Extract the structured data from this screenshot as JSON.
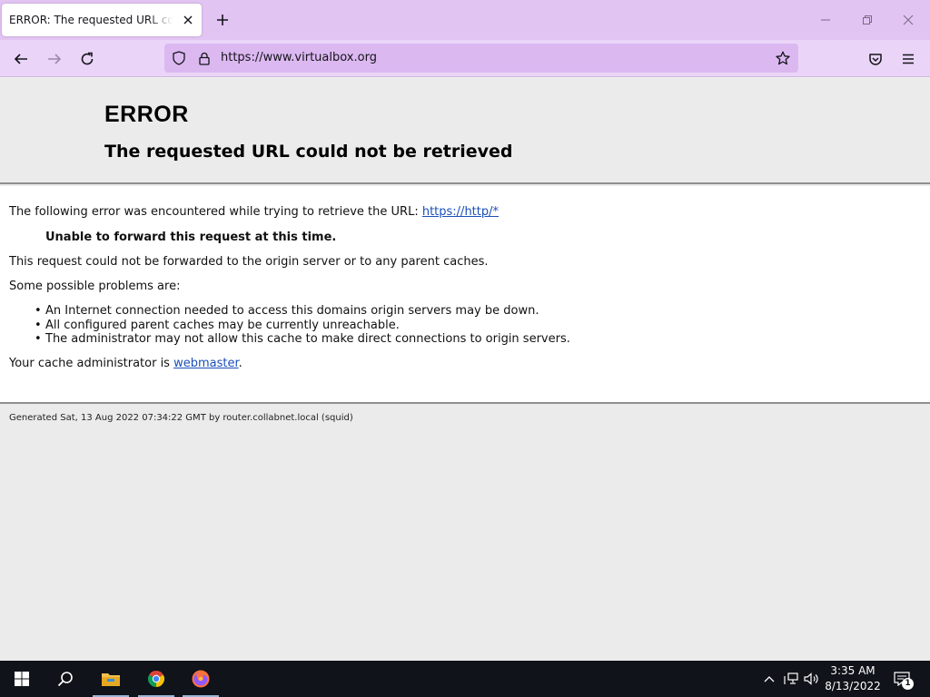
{
  "browser": {
    "tab_title": "ERROR: The requested URL could not be retrieved",
    "url": "https://www.virtualbox.org",
    "icons": {
      "back": "arrow-left-icon",
      "forward": "arrow-right-icon",
      "reload": "reload-icon",
      "shield": "shield-icon",
      "lock": "lock-icon",
      "bookmark": "star-icon",
      "pocket": "pocket-icon",
      "menu": "hamburger-menu-icon",
      "new_tab": "plus-icon",
      "minimize": "minimize-icon",
      "restore": "restore-icon",
      "close": "close-icon"
    }
  },
  "page": {
    "title": "ERROR",
    "subtitle": "The requested URL could not be retrieved",
    "intro_text": "The following error was encountered while trying to retrieve the URL: ",
    "intro_link": "https://http/*",
    "error_summary": "Unable to forward this request at this time.",
    "detail": "This request could not be forwarded to the origin server or to any parent caches.",
    "problems_heading": "Some possible problems are:",
    "problems": [
      "An Internet connection needed to access this domains origin servers may be down.",
      "All configured parent caches may be currently unreachable.",
      "The administrator may not allow this cache to make direct connections to origin servers."
    ],
    "admin_text": "Your cache administrator is ",
    "admin_link": "webmaster",
    "admin_suffix": ".",
    "footer": "Generated Sat, 13 Aug 2022 07:34:22 GMT by router.collabnet.local (squid)"
  },
  "taskbar": {
    "time": "3:35 AM",
    "date": "8/13/2022",
    "notification_count": "1",
    "apps": [
      "start-icon",
      "search-icon",
      "file-explorer-icon",
      "chrome-icon",
      "firefox-icon"
    ]
  },
  "colors": {
    "tab_strip": "#e2c4f3",
    "toolbar": "#ead5f8",
    "url_bar": "#dcb8f1",
    "link": "#1a4fb7",
    "taskbar": "#101319"
  }
}
